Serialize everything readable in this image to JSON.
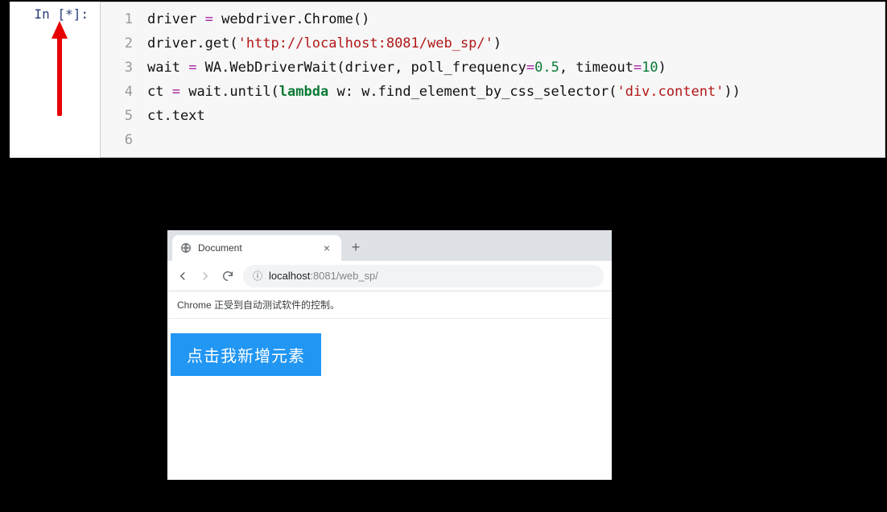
{
  "jupyter": {
    "prompt_label": "In ",
    "prompt_bracket_open": "[",
    "prompt_status": "*",
    "prompt_bracket_close": "]:",
    "line_numbers": [
      "1",
      "2",
      "3",
      "4",
      "5",
      "6"
    ],
    "code": {
      "l1_a": "driver ",
      "l1_eq": "=",
      "l1_b": " webdriver.Chrome()",
      "l2_a": "driver.get(",
      "l2_q1": "'",
      "l2_str": "http://localhost:8081/web_sp/",
      "l2_q2": "'",
      "l2_b": ")",
      "l3": "",
      "l4_a": "wait ",
      "l4_eq": "=",
      "l4_b": " WA.WebDriverWait(driver, poll_frequency",
      "l4_eq2": "=",
      "l4_n1": "0.5",
      "l4_c": ", timeout",
      "l4_eq3": "=",
      "l4_n2": "10",
      "l4_close": ")",
      "l5_a": "ct ",
      "l5_eq": "=",
      "l5_b": " wait.until(",
      "l5_kw": "lambda",
      "l5_c": " w: w.find_element_by_css_selector(",
      "l5_q1": "'",
      "l5_str": "div.content",
      "l5_q2": "'",
      "l5_close": "))",
      "l6": "ct.text"
    }
  },
  "browser": {
    "tab_title": "Document",
    "url_host": "localhost",
    "url_port_path": ":8081/web_sp/",
    "infobar_text": "Chrome 正受到自动测试软件的控制。",
    "button_text": "点击我新增元素"
  },
  "colors": {
    "jupyter_prompt": "#2a3a7a",
    "code_string": "#b21717",
    "code_number": "#0a7a34",
    "code_keyword": "#0a7a34",
    "button_blue": "#2196f3",
    "arrow_red": "#e60000"
  }
}
